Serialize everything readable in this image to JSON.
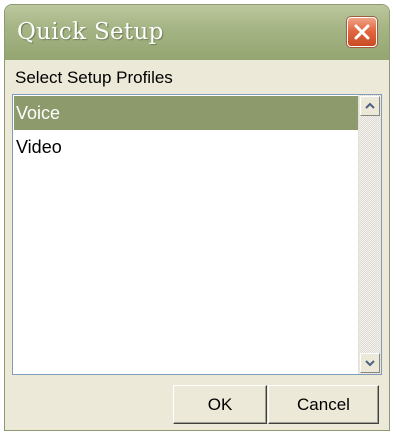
{
  "window": {
    "title": "Quick Setup",
    "close_icon": "close-icon"
  },
  "section": {
    "label": "Select Setup Profiles"
  },
  "profiles": {
    "items": [
      {
        "label": "Voice",
        "selected": true
      },
      {
        "label": "Video",
        "selected": false
      }
    ]
  },
  "buttons": {
    "ok": "OK",
    "cancel": "Cancel"
  },
  "colors": {
    "titlebar": "#a6b585",
    "selection": "#8d9a6c",
    "close_button": "#e26842",
    "dialog_background": "#ece9d8"
  }
}
